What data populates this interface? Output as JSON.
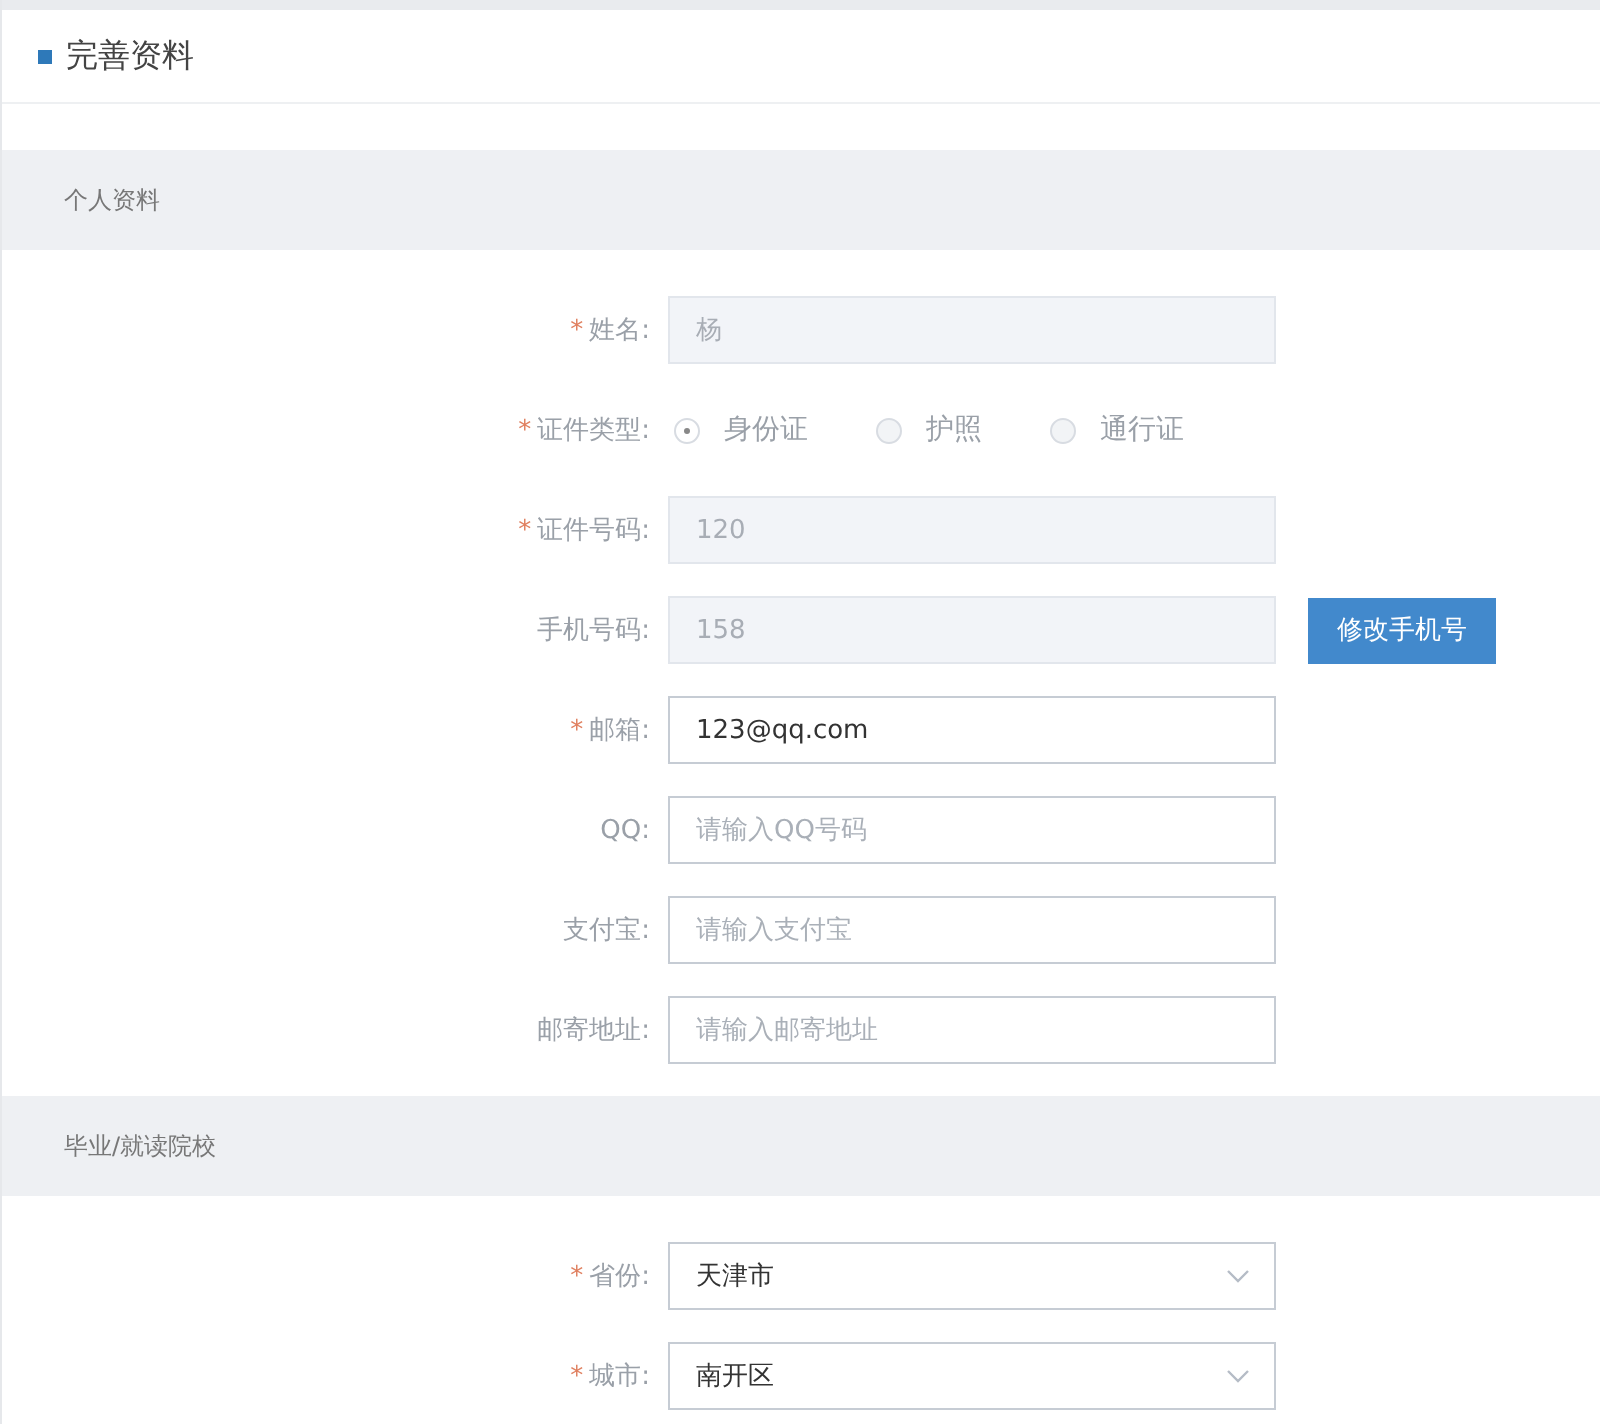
{
  "page": {
    "title": "完善资料"
  },
  "sections": [
    {
      "title": "个人资料",
      "fields": [
        {
          "kind": "text",
          "label": "姓名:",
          "mark": "*",
          "value": "杨",
          "disabled": true
        },
        {
          "kind": "radio",
          "label": "证件类型:",
          "mark": "*",
          "options": [
            {
              "label": "身份证",
              "selected": true
            },
            {
              "label": "护照",
              "selected": false
            },
            {
              "label": "通行证",
              "selected": false
            }
          ]
        },
        {
          "kind": "text",
          "label": "证件号码:",
          "mark": "*",
          "value": "120",
          "disabled": true
        },
        {
          "kind": "text",
          "label": "手机号码:",
          "value": "158",
          "disabled": true,
          "button": "修改手机号"
        },
        {
          "kind": "text",
          "label": "邮箱:",
          "mark": "*",
          "value": "123@qq.com",
          "disabled": false
        },
        {
          "kind": "text",
          "label": "QQ:",
          "placeholder": "请输入QQ号码",
          "disabled": false
        },
        {
          "kind": "text",
          "label": "支付宝:",
          "placeholder": "请输入支付宝",
          "disabled": false
        },
        {
          "kind": "text",
          "label": "邮寄地址:",
          "placeholder": "请输入邮寄地址",
          "disabled": false
        }
      ]
    },
    {
      "title": "毕业/就读院校",
      "fields": [
        {
          "kind": "select",
          "label": "省份:",
          "mark": "*",
          "value": "天津市"
        },
        {
          "kind": "select",
          "label": "城市:",
          "mark": "*",
          "value": "南开区"
        }
      ]
    }
  ]
}
